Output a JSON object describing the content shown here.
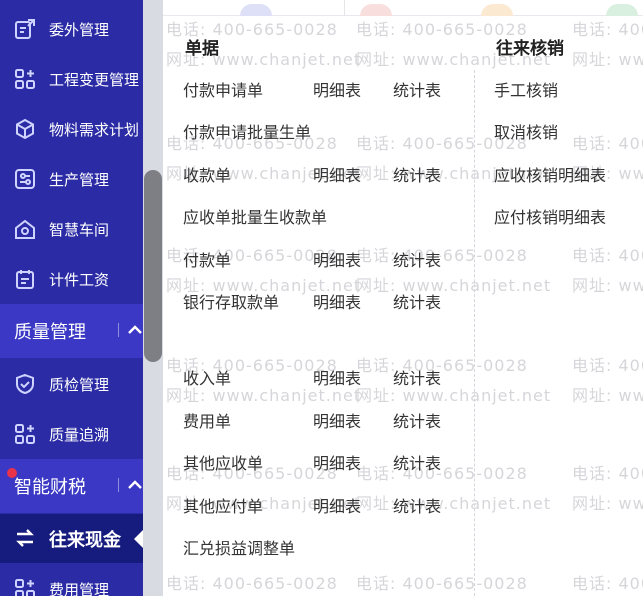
{
  "sidebar": {
    "items_top": [
      {
        "label": "委外管理",
        "icon": "outsource-icon"
      },
      {
        "label": "工程变更管理",
        "icon": "grid-plus-icon"
      },
      {
        "label": "物料需求计划",
        "icon": "cube-icon"
      },
      {
        "label": "生产管理",
        "icon": "sliders-icon"
      },
      {
        "label": "智慧车间",
        "icon": "factory-icon"
      },
      {
        "label": "计件工资",
        "icon": "calendar-icon"
      }
    ],
    "group_quality": {
      "label": "质量管理"
    },
    "items_quality": [
      {
        "label": "质检管理",
        "icon": "shield-check-icon"
      },
      {
        "label": "质量追溯",
        "icon": "grid-plus-icon"
      }
    ],
    "group_finance": {
      "label": "智能财税"
    },
    "active_item": {
      "label": "往来现金",
      "icon": "swap-icon"
    },
    "items_bottom": [
      {
        "label": "费用管理",
        "icon": "grid-plus-icon"
      }
    ]
  },
  "watermark": {
    "phone": "电话: 400-665-0028",
    "site": "网址: www.chanjet.net"
  },
  "panel": {
    "documents": {
      "title": "单据",
      "rows": [
        {
          "name": "付款申请单",
          "detail": "明细表",
          "stats": "统计表"
        },
        {
          "name": "付款申请批量生单"
        },
        {
          "name": "收款单",
          "detail": "明细表",
          "stats": "统计表"
        },
        {
          "name": "应收单批量生收款单"
        },
        {
          "name": "付款单",
          "detail": "明细表",
          "stats": "统计表"
        },
        {
          "name": "银行存取款单",
          "detail": "明细表",
          "stats": "统计表"
        },
        {
          "name": "收入单",
          "detail": "明细表",
          "stats": "统计表"
        },
        {
          "name": "费用单",
          "detail": "明细表",
          "stats": "统计表"
        },
        {
          "name": "其他应收单",
          "detail": "明细表",
          "stats": "统计表"
        },
        {
          "name": "其他应付单",
          "detail": "明细表",
          "stats": "统计表"
        },
        {
          "name": "汇兑损益调整单"
        }
      ]
    },
    "writeoff": {
      "title": "往来核销",
      "items": [
        "手工核销",
        "取消核销",
        "应收核销明细表",
        "应付核销明细表"
      ]
    }
  },
  "colors": {
    "sidebar_bg": "#2b2ca5",
    "group_bg": "#3a38c4",
    "active_bg": "#161b7e",
    "badge": "#e8334a"
  }
}
